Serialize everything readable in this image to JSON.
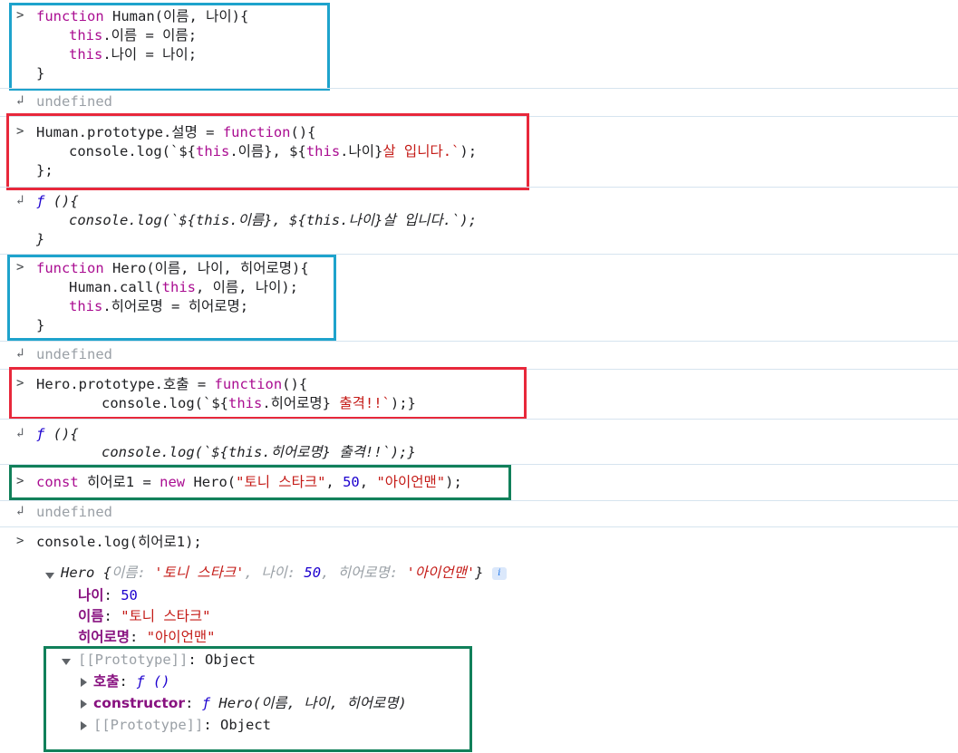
{
  "console": {
    "entry1": {
      "l1": {
        "kw": "function",
        "name": " Human(이름, 나이){"
      },
      "l2": {
        "this": "this",
        "rest": ".이름 = 이름;"
      },
      "l3": {
        "this": "this",
        "rest": ".나이 = 나이;"
      },
      "l4": "}"
    },
    "result1": "undefined",
    "entry2": {
      "l1": {
        "pre": "Human.prototype.설명 = ",
        "kw": "function",
        "post": "(){"
      },
      "l2": {
        "pre": "console.log(`${",
        "this": "this",
        "mid": ".이름}, ${",
        "this2": "this",
        "mid2": ".나이}",
        "str": "살 입니다.`",
        "post": ");"
      },
      "l3": "};"
    },
    "result2": {
      "f": "ƒ",
      "l1": " (){",
      "l2": "console.log(`${this.이름}, ${this.나이}살 입니다.`);",
      "l3": "}"
    },
    "entry3": {
      "l1": {
        "kw": "function",
        "name": " Hero(이름, 나이, 히어로명){"
      },
      "l2": {
        "pre": "Human.call(",
        "this": "this",
        "post": ", 이름, 나이);"
      },
      "l3": {
        "this": "this",
        "rest": ".히어로명 = 히어로명;"
      },
      "l4": "}"
    },
    "result3": "undefined",
    "entry4": {
      "l1": {
        "pre": "Hero.prototype.호출 = ",
        "kw": "function",
        "post": "(){"
      },
      "l2": {
        "pre": "console.log(`${",
        "this": "this",
        "mid": ".히어로명}",
        "str": " 출격!!`",
        "post": ");}"
      }
    },
    "result4": {
      "f": "ƒ",
      "l1": " (){",
      "l2": "console.log(`${this.히어로명} 출격!!`);}"
    },
    "entry5": {
      "kw": "const",
      "var": " 히어로1 = ",
      "kw2": "new",
      "cls": " Hero(",
      "s1": "\"토니 스타크\"",
      "c1": ", ",
      "n": "50",
      "c2": ", ",
      "s2": "\"아이언맨\"",
      "end": ");"
    },
    "result5": "undefined",
    "entry6": "console.log(히어로1);",
    "object": {
      "summary_cls": "Hero ",
      "summary_open": "{",
      "k1": "이름",
      "v1": "'토니 스타크'",
      "k2": "나이",
      "v2": "50",
      "k3": "히어로명",
      "v3": "'아이언맨'",
      "summary_close": "}",
      "info": "i",
      "props": [
        {
          "key": "나이",
          "value": "50"
        },
        {
          "key": "이름",
          "value": "\"토니 스타크\""
        },
        {
          "key": "히어로명",
          "value": "\"아이언맨\""
        }
      ],
      "proto_label": "[[Prototype]]",
      "proto_value": "Object",
      "proto_items": {
        "call_key": "호출",
        "call_value": "ƒ ()",
        "ctor_key": "constructor",
        "ctor_f": "ƒ",
        "ctor_value": " Hero(이름, 나이, 히어로명)",
        "inner_proto_label": "[[Prototype]]",
        "inner_proto_value": "Object"
      }
    }
  },
  "colors": {
    "box_blue": "#1ea3cc",
    "box_red": "#e8283b",
    "box_green": "#11805a",
    "keyword": "#aa0d91",
    "string": "#c41a16",
    "number": "#1c00cf"
  },
  "icons": {
    "prompt": "chevron-right-icon",
    "result": "return-arrow-icon",
    "expand": "triangle-down-icon",
    "collapse": "triangle-right-icon"
  }
}
